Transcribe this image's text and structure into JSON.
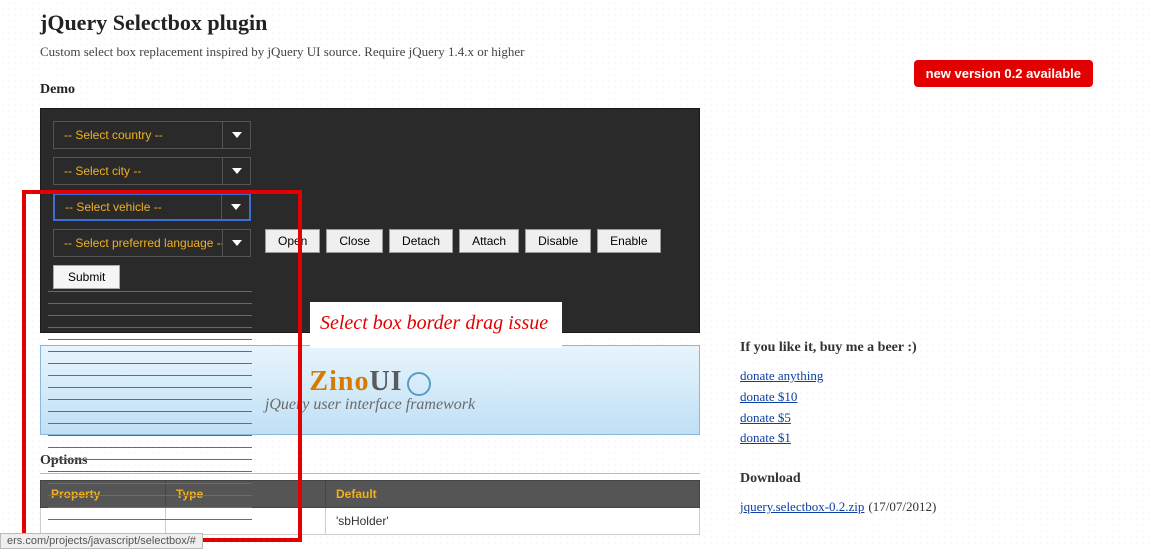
{
  "header": {
    "title": "jQuery Selectbox plugin",
    "subtitle": "Custom select box replacement inspired by jQuery UI source. Require jQuery 1.4.x or higher",
    "badge": "new version 0.2 available"
  },
  "sections": {
    "demo": "Demo",
    "options": "Options",
    "like": "If you like it, buy me a beer :)",
    "download": "Download"
  },
  "selects": {
    "country": "-- Select country --",
    "city": "-- Select city --",
    "vehicle": "-- Select vehicle --",
    "language": "-- Select preferred language --"
  },
  "buttons": {
    "open": "Open",
    "close": "Close",
    "detach": "Detach",
    "attach": "Attach",
    "disable": "Disable",
    "enable": "Enable",
    "submit": "Submit"
  },
  "banner": {
    "logo_left": "Zino",
    "logo_right": "UI",
    "tagline": "jQuery user interface framework"
  },
  "options_table": {
    "headers": {
      "property": "Property",
      "type": "Type",
      "default": "Default"
    },
    "row0": {
      "default": "'sbHolder'"
    }
  },
  "donate": {
    "anything": "donate anything",
    "d10": "donate $10",
    "d5": "donate $5",
    "d1": "donate $1"
  },
  "download_link": {
    "file": "jquery.selectbox-0.2.zip",
    "date": "(17/07/2012)"
  },
  "annotation": {
    "text": "Select box border drag issue"
  },
  "status": "ers.com/projects/javascript/selectbox/#"
}
